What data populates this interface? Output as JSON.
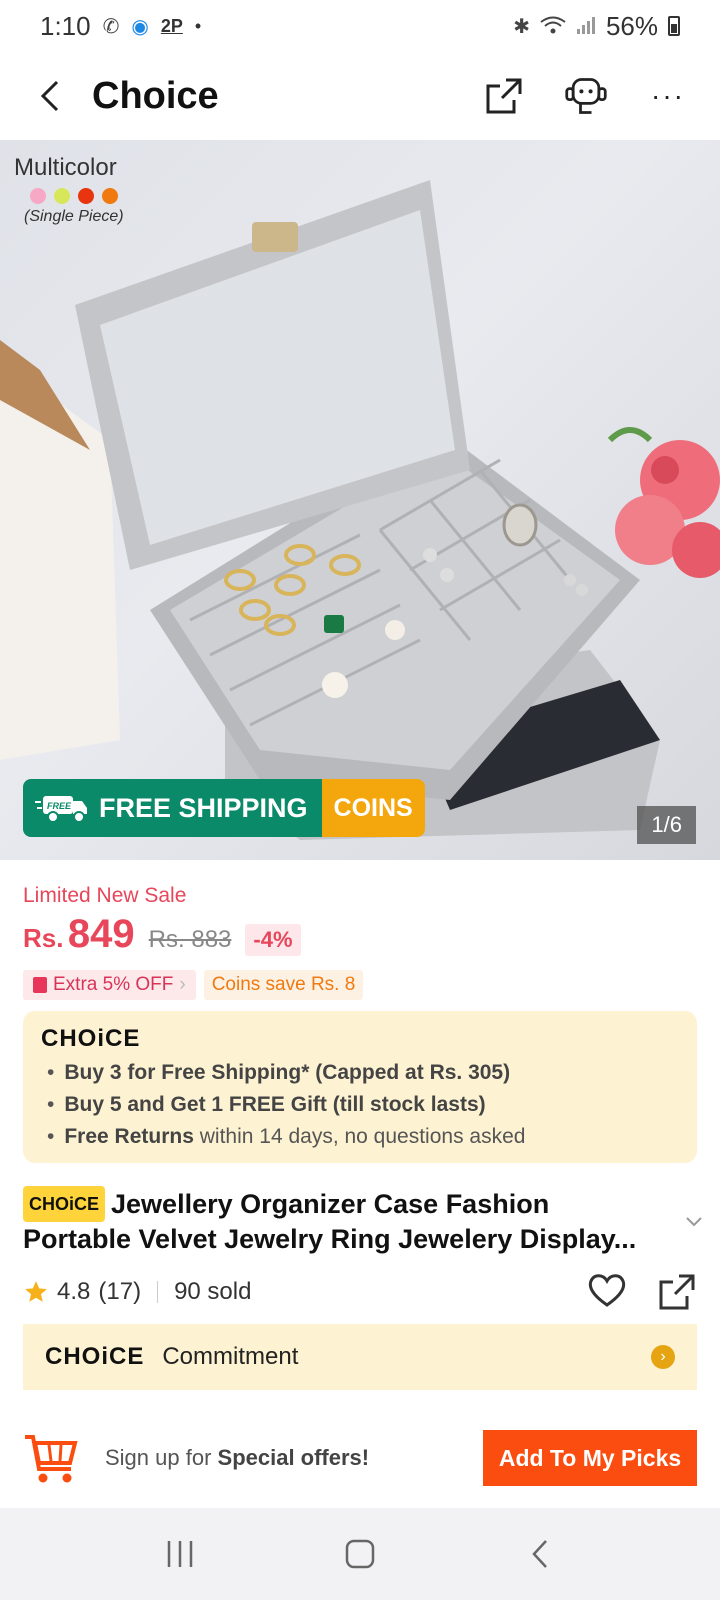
{
  "status_bar": {
    "time": "1:10",
    "indicator_2p": "2P",
    "dot": "•",
    "battery": "56%",
    "icons": [
      "missed-call-icon",
      "imo-icon",
      "bluetooth-icon",
      "wifi-icon",
      "signal-icon",
      "battery-icon"
    ]
  },
  "header": {
    "title": "Choice",
    "back_icon": "chevron-left-icon",
    "actions": [
      "share-icon",
      "support-icon",
      "more-icon"
    ],
    "more_label": "···"
  },
  "gallery": {
    "variant_name": "Multicolor",
    "variant_note": "(Single Piece)",
    "variant_colors": [
      "#f7a8c4",
      "#d6e85a",
      "#e8350f",
      "#f07a10"
    ],
    "shipping_badge": "FREE",
    "shipping_label": "FREE SHIPPING",
    "coins_label": "COINS",
    "counter": "1/6"
  },
  "price": {
    "sale_label": "Limited New Sale",
    "currency": "Rs.",
    "current": "849",
    "original": "Rs. 883",
    "discount": "-4%"
  },
  "promos": {
    "extra_off": "Extra 5% OFF",
    "extra_chevron": "›",
    "coins_save": "Coins save Rs. 8"
  },
  "choice_benefits": {
    "logo": "CHOiCE",
    "bullet": "•",
    "items": [
      {
        "bold": "Buy 3 for  Free Shipping* (Capped at Rs. 305)",
        "rest": ""
      },
      {
        "bold": "Buy 5 and Get 1 FREE Gift (till stock lasts)",
        "rest": ""
      },
      {
        "bold": "Free Returns",
        "rest": " within 14 days, no questions asked"
      }
    ]
  },
  "product": {
    "badge": "CHOiCE",
    "title": "Jewellery Organizer Case Fashion Portable Velvet Jewelry Ring Jewelery Display..."
  },
  "rating": {
    "score": "4.8",
    "count": "(17)",
    "sold": "90 sold"
  },
  "commitment": {
    "logo": "CHOiCE",
    "label": "Commitment",
    "arrow": "›"
  },
  "cta": {
    "signup_prefix": "Sign up for ",
    "signup_bold": "Special offers!",
    "button": "Add To My Picks"
  },
  "colors": {
    "accent_red": "#e8465a",
    "cta_orange": "#fa4d0f",
    "ship_green": "#0a8a68",
    "coins_gold": "#f4a60d",
    "choice_cream": "#fdf2d2"
  }
}
